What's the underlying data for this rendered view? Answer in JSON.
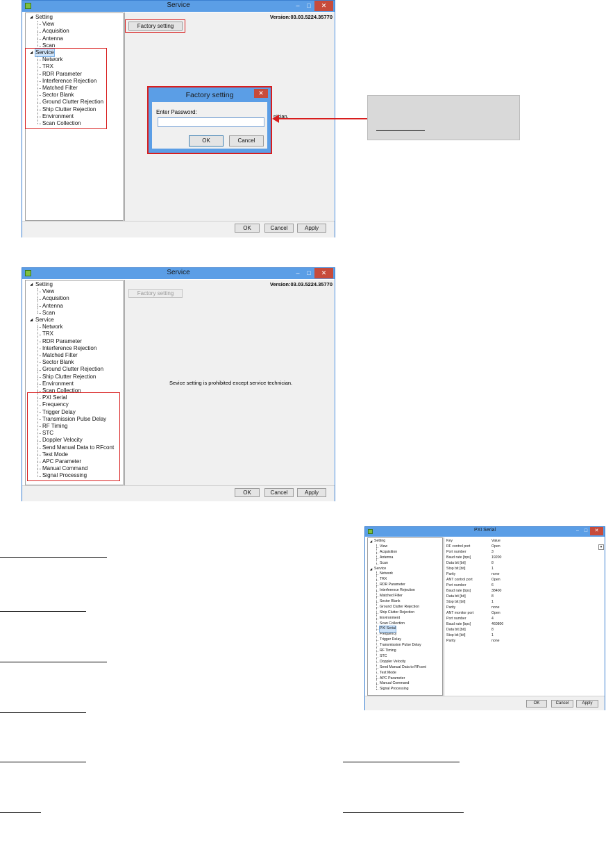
{
  "window1": {
    "title": "Service",
    "version": "Version:03.03.5224.35770",
    "factory_button": "Factory setting",
    "tree": [
      "Setting",
      "View",
      "Acquisition",
      "Antenna",
      "Scan",
      "Service",
      "Network",
      "TRX",
      "RDR Parameter",
      "Interference Rejection",
      "Matched Filter",
      "Sector Blank",
      "Ground Clutter Rejection",
      "Ship Clutter Rejection",
      "Environment",
      "Scan Collection"
    ],
    "message_partial": "nician.",
    "buttons": {
      "ok": "OK",
      "cancel": "Cancel",
      "apply": "Apply"
    }
  },
  "dialog": {
    "title": "Factory setting",
    "label": "Enter Password:",
    "ok": "OK",
    "cancel": "Cancel",
    "close": "✕"
  },
  "window2": {
    "title": "Service",
    "version": "Version:03.03.5224.35770",
    "factory_button": "Factory setting",
    "message": "Sevice setting is prohibited except service technician.",
    "tree": [
      "Setting",
      "View",
      "Acquisition",
      "Antenna",
      "Scan",
      "Service",
      "Network",
      "TRX",
      "RDR Parameter",
      "Interference Rejection",
      "Matched Filter",
      "Sector Blank",
      "Ground Clutter Rejection",
      "Ship Clutter Rejection",
      "Environment",
      "Scan Collection",
      "PXI Serial",
      "Frequency",
      "Trigger Delay",
      "Transmission Pulse Delay",
      "RF Timing",
      "STC",
      "Doppler Velocity",
      "Send Manual Data to RFcont",
      "Test Mode",
      "APC Parameter",
      "Manual Command",
      "Signal Processing"
    ],
    "buttons": {
      "ok": "OK",
      "cancel": "Cancel",
      "apply": "Apply"
    }
  },
  "window3": {
    "title": "PXI Serial",
    "tree": [
      "Setting",
      "View",
      "Acquisition",
      "Antenna",
      "Scan",
      "Service",
      "Network",
      "TRX",
      "RDR Parameter",
      "Interference Rejection",
      "Matched Filter",
      "Sector Blank",
      "Ground Clutter Rejection",
      "Ship Clutter Rejection",
      "Environment",
      "Scan Collection",
      "PXI Serial",
      "Frequency",
      "Trigger Delay",
      "Transmission Pulse Delay",
      "RF Timing",
      "STC",
      "Doppler Velocity",
      "Send Manual Data to RFcont",
      "Test Mode",
      "APC Parameter",
      "Manual Command",
      "Signal Processing"
    ],
    "header": {
      "key": "Key",
      "value": "Value"
    },
    "rows": [
      {
        "key": "RF control port",
        "value": "Open"
      },
      {
        "key": "Port number",
        "value": "3"
      },
      {
        "key": "Baud rate [bps]",
        "value": "19200"
      },
      {
        "key": "Data bit [bit]",
        "value": "8"
      },
      {
        "key": "Stop bit [bit]",
        "value": "1"
      },
      {
        "key": "Parity",
        "value": "none"
      },
      {
        "key": "ANT control port",
        "value": "Open"
      },
      {
        "key": "Port number",
        "value": "6"
      },
      {
        "key": "Baud rate [bps]",
        "value": "38400"
      },
      {
        "key": "Data bit [bit]",
        "value": "8"
      },
      {
        "key": "Stop bit [bit]",
        "value": "1"
      },
      {
        "key": "Parity",
        "value": "none"
      },
      {
        "key": "ANT monitor port",
        "value": "Open"
      },
      {
        "key": "Port number",
        "value": "4"
      },
      {
        "key": "Baud rate [bps]",
        "value": "460800"
      },
      {
        "key": "Data bit [bit]",
        "value": "8"
      },
      {
        "key": "Stop bit [bit]",
        "value": "1"
      },
      {
        "key": "Parity",
        "value": "none"
      }
    ],
    "buttons": {
      "ok": "OK",
      "cancel": "Cancel",
      "apply": "Apply"
    }
  },
  "colors": {
    "titlebar": "#5b9ee6",
    "close": "#c74b3b",
    "highlight_box": "#d81e1e",
    "arrow": "#d81e1e",
    "callout": "#d9d9d9"
  }
}
